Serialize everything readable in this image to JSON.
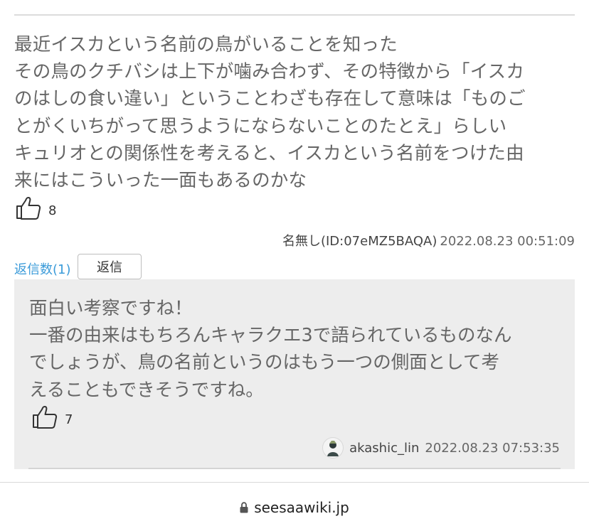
{
  "comment": {
    "lines": [
      "最近イスカという名前の鳥がいることを知った",
      "その鳥のクチバシは上下が噛み合わず、その特徴から「イスカ",
      "のはしの食い違い」ということわざも存在して意味は「ものご",
      "とがくいちがって思うようにならないことのたとえ」らしい",
      "キュリオとの関係性を考えると、イスカという名前をつけた由",
      "来にはこういった一面もあるのかな"
    ],
    "likes": "8",
    "author": "名無し(ID:07eMZ5BAQA)",
    "date": "2022.08.23 00:51:09"
  },
  "replies": {
    "count_label": "返信数(1)",
    "button_label": "返信"
  },
  "reply": {
    "lines": [
      "面白い考察ですね！",
      "一番の由来はもちろんキャラクエ3で語られているものなん",
      "でしょうが、鳥の名前というのはもう一つの側面として考",
      "えることもできそうですね。"
    ],
    "likes": "7",
    "author": "akashic_lin",
    "date": "2022.08.23 07:53:35"
  },
  "browser": {
    "url": "seesaawiki.jp",
    "lock_icon": "lock-icon"
  }
}
